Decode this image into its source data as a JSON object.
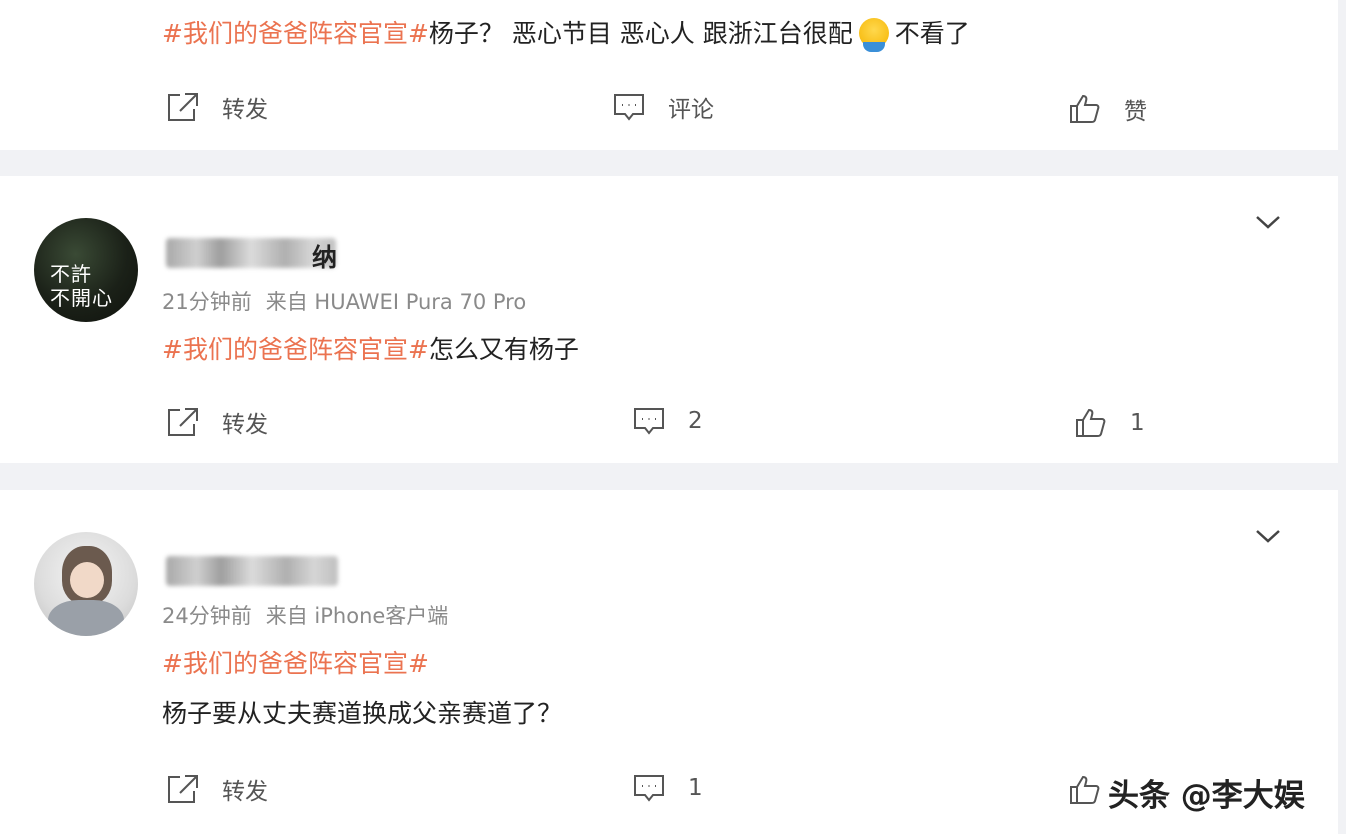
{
  "posts": [
    {
      "hashtag": "#我们的爸爸阵容官宣#",
      "text": "杨子？ 恶心节目 恶心人 跟浙江台很配",
      "emoji": "sick-face-emoji",
      "text_after": "不看了",
      "actions": {
        "repost": "转发",
        "comment": "评论",
        "like": "赞"
      }
    },
    {
      "avatar_text": "不許\n不開心",
      "name_visible": "纳",
      "time": "21分钟前",
      "source": "来自 HUAWEI Pura 70 Pro",
      "hashtag": "#我们的爸爸阵容官宣#",
      "text": "怎么又有杨子",
      "actions": {
        "repost": "转发",
        "comment": "2",
        "like": "1"
      }
    },
    {
      "time": "24分钟前",
      "source": "来自 iPhone客户端",
      "hashtag": "#我们的爸爸阵容官宣#",
      "text": "杨子要从丈夫赛道换成父亲赛道了？",
      "actions": {
        "repost": "转发",
        "comment": "1"
      }
    }
  ],
  "watermark": "头条 @李大娱",
  "colors": {
    "hashtag": "#eb7350",
    "background": "#f1f2f5",
    "card": "#ffffff"
  }
}
